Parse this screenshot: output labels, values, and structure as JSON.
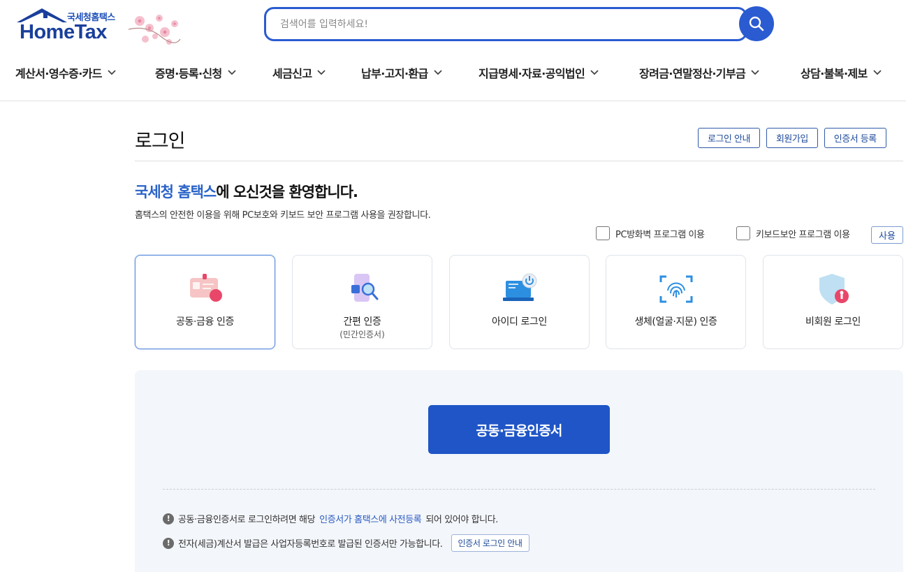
{
  "header": {
    "logo_sub": "국세청홈택스",
    "logo_main": "HomeTax",
    "search_placeholder": "검색어를 입력하세요!"
  },
  "nav": [
    {
      "label": "계산서·영수증·카드"
    },
    {
      "label": "증명·등록·신청"
    },
    {
      "label": "세금신고"
    },
    {
      "label": "납부·고지·환급"
    },
    {
      "label": "지급명세·자료·공익법인"
    },
    {
      "label": "장려금·연말정산·기부금"
    },
    {
      "label": "상담·불복·제보"
    }
  ],
  "page": {
    "title": "로그인",
    "top_buttons": [
      "로그인 안내",
      "회원가입",
      "인증서 등록"
    ],
    "welcome_highlight": "국세청 홈택스",
    "welcome_rest": "에 오신것을 환영합니다.",
    "notice": "홈택스의 안전한 이용을 위해 PC보호와 키보드 보안 프로그램 사용을 권장합니다.",
    "option_firewall": "PC방화벽 프로그램 이용",
    "option_keyboard": "키보드보안 프로그램 이용",
    "use_button": "사용"
  },
  "login_methods": [
    {
      "label": "공동·금융 인증",
      "sub": "",
      "icon": "certificate-card-icon",
      "selected": true
    },
    {
      "label": "간편 인증",
      "sub": "(민간인증서)",
      "icon": "phone-search-icon",
      "selected": false
    },
    {
      "label": "아이디 로그인",
      "sub": "",
      "icon": "laptop-power-icon",
      "selected": false
    },
    {
      "label": "생체(얼굴·지문) 인증",
      "sub": "",
      "icon": "fingerprint-icon",
      "selected": false
    },
    {
      "label": "비회원 로그인",
      "sub": "",
      "icon": "shield-key-icon",
      "selected": false
    }
  ],
  "panel": {
    "main_button": "공동·금융인증서",
    "info1_a": "공동·금융인증서로 로그인하려면 해당 ",
    "info1_link": "인증서가 홈택스에 사전등록",
    "info1_b": "되어 있어야 합니다.",
    "info2": "전자(세금)계산서 발급은 사업자등록번호로 발급된 인증서만 가능합니다.",
    "info2_button": "인증서 로그인 안내"
  },
  "colors": {
    "brand": "#1f55c6",
    "accent_text": "#2a63c9",
    "panel_bg": "#f3f6fa"
  }
}
